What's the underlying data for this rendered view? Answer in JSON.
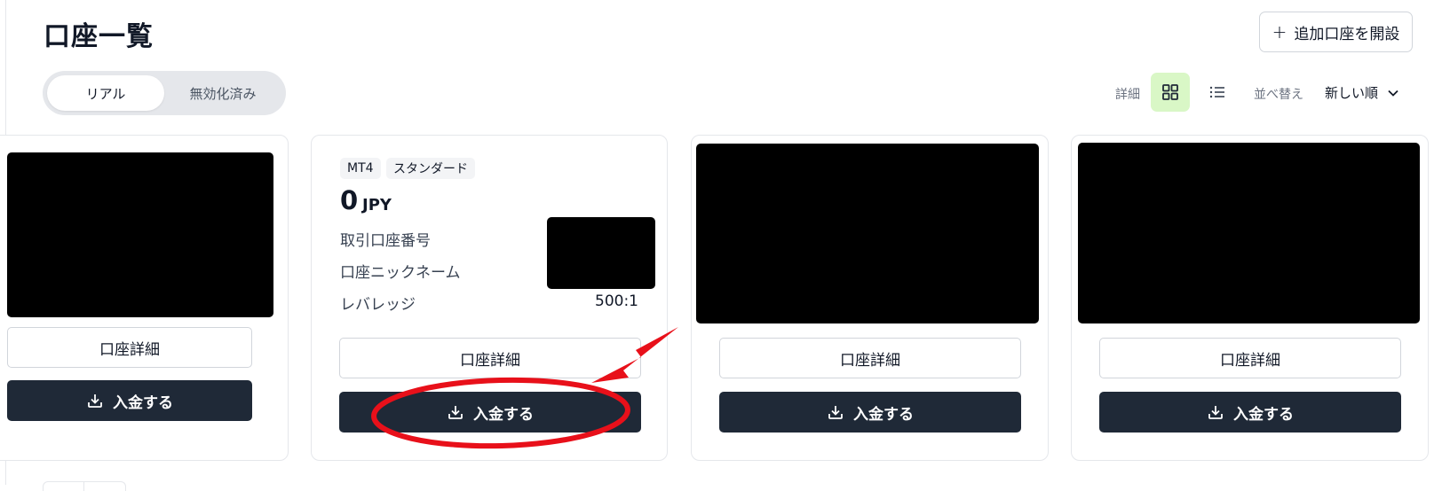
{
  "header": {
    "title": "口座一覧",
    "open_account_label": "追加口座を開設",
    "open_account_icon": "plus-icon"
  },
  "tabs": [
    {
      "label": "リアル",
      "active": true
    },
    {
      "label": "無効化済み",
      "active": false
    }
  ],
  "view": {
    "detail_label": "詳細",
    "grid_icon": "grid-icon",
    "list_icon": "list-icon",
    "active_view": "grid",
    "sort_label": "並べ替え",
    "sort_value": "新しい順"
  },
  "cards": [
    {
      "redacted": true,
      "detail_label": "口座詳細",
      "deposit_label": "入金する"
    },
    {
      "redacted": false,
      "platform": "MT4",
      "account_type": "スタンダード",
      "balance": "0",
      "currency": "JPY",
      "rows": [
        {
          "label": "取引口座番号",
          "value": ""
        },
        {
          "label": "口座ニックネーム",
          "value": ""
        },
        {
          "label": "レバレッジ",
          "value": "500:1"
        }
      ],
      "detail_label": "口座詳細",
      "deposit_label": "入金する"
    },
    {
      "redacted": true,
      "detail_label": "口座詳細",
      "deposit_label": "入金する"
    },
    {
      "redacted": true,
      "detail_label": "口座詳細",
      "deposit_label": "入金する"
    }
  ],
  "colors": {
    "primary_dark": "#1f2937",
    "grid_active_bg": "#d9f7c6",
    "annotation_red": "#e8101a"
  }
}
